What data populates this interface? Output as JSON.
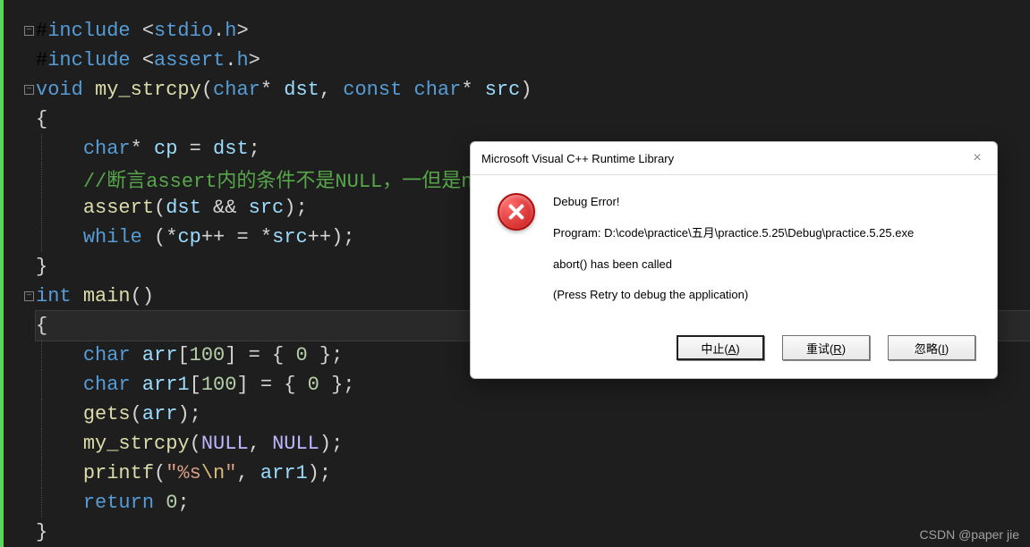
{
  "code": {
    "lines": [
      {
        "tokens": [
          [
            "def",
            "#"
          ],
          [
            "k-blue",
            "include "
          ],
          [
            "k-ang",
            "<"
          ],
          [
            "k-blue",
            "stdio"
          ],
          [
            "k-punct",
            "."
          ],
          [
            "k-blue",
            "h"
          ],
          [
            "k-ang",
            ">"
          ]
        ]
      },
      {
        "tokens": [
          [
            "def",
            "#"
          ],
          [
            "k-blue",
            "include "
          ],
          [
            "k-ang",
            "<"
          ],
          [
            "k-blue",
            "assert"
          ],
          [
            "k-punct",
            "."
          ],
          [
            "k-blue",
            "h"
          ],
          [
            "k-ang",
            ">"
          ]
        ]
      },
      {
        "tokens": [
          [
            "k-blue",
            "void "
          ],
          [
            "k-func",
            "my_strcpy"
          ],
          [
            "k-punct",
            "("
          ],
          [
            "k-blue",
            "char"
          ],
          [
            "k-punct",
            "* "
          ],
          [
            "k-var",
            "dst"
          ],
          [
            "k-punct",
            ", "
          ],
          [
            "k-blue",
            "const "
          ],
          [
            "k-blue",
            "char"
          ],
          [
            "k-punct",
            "* "
          ],
          [
            "k-var",
            "src"
          ],
          [
            "k-punct",
            ")"
          ]
        ]
      },
      {
        "tokens": [
          [
            "k-punct",
            "{"
          ]
        ]
      },
      {
        "indent": 1,
        "tokens": [
          [
            "k-blue",
            "char"
          ],
          [
            "k-punct",
            "* "
          ],
          [
            "k-var",
            "cp"
          ],
          [
            "k-punct",
            " = "
          ],
          [
            "k-var",
            "dst"
          ],
          [
            "k-punct",
            ";"
          ]
        ]
      },
      {
        "indent": 1,
        "tokens": [
          [
            "k-comment",
            "//断言assert内的条件不是NULL，一但是nu"
          ]
        ]
      },
      {
        "indent": 1,
        "tokens": [
          [
            "k-func",
            "assert"
          ],
          [
            "k-punct",
            "("
          ],
          [
            "k-var",
            "dst"
          ],
          [
            "k-punct",
            " && "
          ],
          [
            "k-var",
            "src"
          ],
          [
            "k-punct",
            ");"
          ]
        ]
      },
      {
        "indent": 1,
        "tokens": [
          [
            "k-blue",
            "while "
          ],
          [
            "k-punct",
            "(*"
          ],
          [
            "k-var",
            "cp"
          ],
          [
            "k-punct",
            "++ = *"
          ],
          [
            "k-var",
            "src"
          ],
          [
            "k-punct",
            "++);"
          ]
        ]
      },
      {
        "tokens": [
          [
            "k-punct",
            "}"
          ]
        ]
      },
      {
        "tokens": [
          [
            "k-blue",
            "int "
          ],
          [
            "k-func",
            "main"
          ],
          [
            "k-punct",
            "()"
          ]
        ]
      },
      {
        "highlight": true,
        "tokens": [
          [
            "k-punct",
            "{"
          ]
        ]
      },
      {
        "indent": 1,
        "tokens": [
          [
            "k-blue",
            "char "
          ],
          [
            "k-var",
            "arr"
          ],
          [
            "k-punct",
            "["
          ],
          [
            "k-num",
            "100"
          ],
          [
            "k-punct",
            "] = { "
          ],
          [
            "k-num",
            "0"
          ],
          [
            "k-punct",
            " };"
          ]
        ]
      },
      {
        "indent": 1,
        "tokens": [
          [
            "k-blue",
            "char "
          ],
          [
            "k-var",
            "arr1"
          ],
          [
            "k-punct",
            "["
          ],
          [
            "k-num",
            "100"
          ],
          [
            "k-punct",
            "] = { "
          ],
          [
            "k-num",
            "0"
          ],
          [
            "k-punct",
            " };"
          ]
        ]
      },
      {
        "indent": 1,
        "tokens": [
          [
            "k-func",
            "gets"
          ],
          [
            "k-punct",
            "("
          ],
          [
            "k-var",
            "arr"
          ],
          [
            "k-punct",
            ");"
          ]
        ]
      },
      {
        "indent": 1,
        "tokens": [
          [
            "k-func",
            "my_strcpy"
          ],
          [
            "k-punct",
            "("
          ],
          [
            "k-macro",
            "NULL"
          ],
          [
            "k-punct",
            ", "
          ],
          [
            "k-macro",
            "NULL"
          ],
          [
            "k-punct",
            ");"
          ]
        ]
      },
      {
        "indent": 1,
        "tokens": [
          [
            "k-func",
            "printf"
          ],
          [
            "k-punct",
            "("
          ],
          [
            "k-str",
            "\"%s"
          ],
          [
            "k-esc",
            "\\n"
          ],
          [
            "k-str",
            "\""
          ],
          [
            "k-punct",
            ", "
          ],
          [
            "k-var",
            "arr1"
          ],
          [
            "k-punct",
            ");"
          ]
        ]
      },
      {
        "indent": 1,
        "tokens": [
          [
            "k-blue",
            "return "
          ],
          [
            "k-num",
            "0"
          ],
          [
            "k-punct",
            ";"
          ]
        ]
      },
      {
        "tokens": [
          [
            "k-punct",
            "}"
          ]
        ]
      }
    ],
    "fold_marks": {
      "0": true,
      "2": true,
      "9": true
    }
  },
  "dialog": {
    "title": "Microsoft Visual C++ Runtime Library",
    "heading": "Debug Error!",
    "program_label": "Program: D:\\code\\practice\\五月\\practice.5.25\\Debug\\practice.5.25.exe",
    "abort_msg": "abort() has been called",
    "hint": "(Press Retry to debug the application)",
    "buttons": {
      "abort": {
        "prefix": "中止(",
        "underline": "A",
        "suffix": ")"
      },
      "retry": {
        "prefix": "重试(",
        "underline": "R",
        "suffix": ")"
      },
      "ignore": {
        "prefix": "忽略(",
        "underline": "I",
        "suffix": ")"
      }
    }
  },
  "watermark": "CSDN @paper jie"
}
